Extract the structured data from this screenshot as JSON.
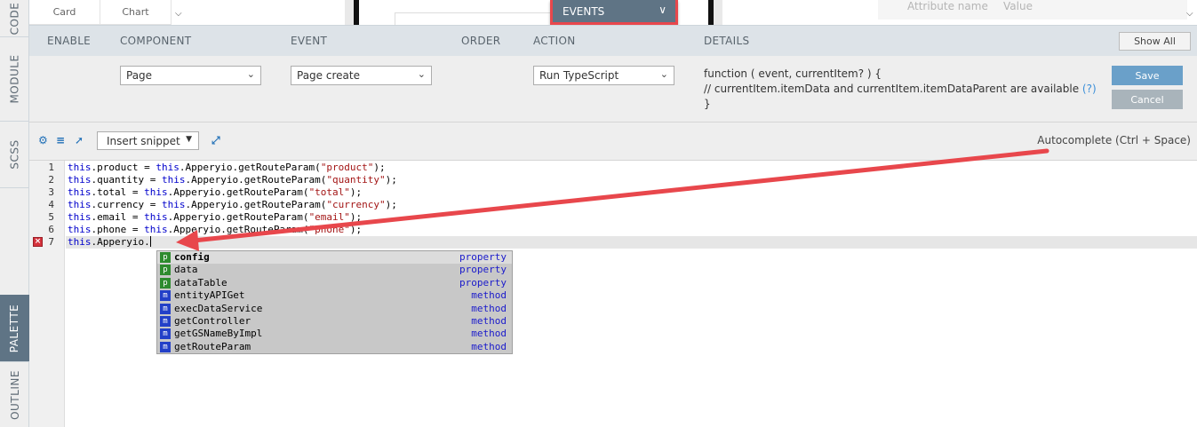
{
  "side_tabs": [
    "CODE",
    "MODULE",
    "SCSS",
    "PALETTE",
    "OUTLINE"
  ],
  "top": {
    "card_label": "Card",
    "chart_label": "Chart",
    "events_label": "EVENTS",
    "attr_name_placeholder": "Attribute name",
    "attr_value_placeholder": "Value"
  },
  "header": {
    "enable": "ENABLE",
    "component": "COMPONENT",
    "event": "EVENT",
    "order": "ORDER",
    "action": "ACTION",
    "details": "DETAILS",
    "show_all": "Show All"
  },
  "event_row": {
    "component_value": "Page",
    "event_value": "Page create",
    "action_value": "Run TypeScript",
    "details_line1": "function ( event, currentItem? ) {",
    "details_line2": "// currentItem.itemData and currentItem.itemDataParent are available",
    "details_help": "(?)",
    "details_line3": "}",
    "save": "Save",
    "cancel": "Cancel"
  },
  "toolbar": {
    "insert_snippet": "Insert snippet",
    "autocomplete_hint": "Autocomplete (Ctrl + Space)"
  },
  "code": {
    "line_numbers": [
      "1",
      "2",
      "3",
      "4",
      "5",
      "6",
      "7"
    ],
    "lines": [
      {
        "a": "this",
        "b": ".product = ",
        "c": "this",
        "d": ".Apperyio.getRouteParam(",
        "e": "\"product\"",
        "f": ");"
      },
      {
        "a": "this",
        "b": ".quantity = ",
        "c": "this",
        "d": ".Apperyio.getRouteParam(",
        "e": "\"quantity\"",
        "f": ");"
      },
      {
        "a": "this",
        "b": ".total = ",
        "c": "this",
        "d": ".Apperyio.getRouteParam(",
        "e": "\"total\"",
        "f": ");"
      },
      {
        "a": "this",
        "b": ".currency = ",
        "c": "this",
        "d": ".Apperyio.getRouteParam(",
        "e": "\"currency\"",
        "f": ");"
      },
      {
        "a": "this",
        "b": ".email = ",
        "c": "this",
        "d": ".Apperyio.getRouteParam(",
        "e": "\"email\"",
        "f": ");"
      },
      {
        "a": "this",
        "b": ".phone = ",
        "c": "this",
        "d": ".Apperyio.getRouteParam(",
        "e": "\"phone\"",
        "f": ");"
      }
    ],
    "line7_kw": "this",
    "line7_rest": ".Apperyio."
  },
  "autocomplete": [
    {
      "badge": "p",
      "name": "config",
      "kind": "property"
    },
    {
      "badge": "p",
      "name": "data",
      "kind": "property"
    },
    {
      "badge": "p",
      "name": "dataTable",
      "kind": "property"
    },
    {
      "badge": "m",
      "name": "entityAPIGet",
      "kind": "method"
    },
    {
      "badge": "m",
      "name": "execDataService",
      "kind": "method"
    },
    {
      "badge": "m",
      "name": "getController",
      "kind": "method"
    },
    {
      "badge": "m",
      "name": "getGSNameByImpl",
      "kind": "method"
    },
    {
      "badge": "m",
      "name": "getRouteParam",
      "kind": "method"
    }
  ],
  "icons": {
    "settings": "gear-icon",
    "format": "indent-icon",
    "pin": "pin-icon",
    "expand": "expand-icon",
    "error": "error-icon"
  },
  "colors": {
    "accent": "#5f7485",
    "highlight": "#e8474c",
    "save": "#6aa0c9",
    "keyword": "#0000cc",
    "string": "#a31515"
  }
}
